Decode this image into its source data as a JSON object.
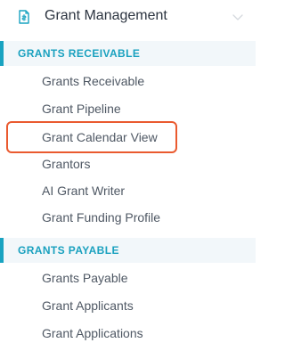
{
  "header": {
    "title": "Grant Management",
    "icon": "document-icon",
    "expand_icon": "chevron-down-icon"
  },
  "sections": [
    {
      "label": "GRANTS RECEIVABLE",
      "items": [
        {
          "label": "Grants Receivable"
        },
        {
          "label": "Grant Pipeline"
        },
        {
          "label": "Grant Calendar View",
          "highlighted": true
        },
        {
          "label": "Grantors"
        },
        {
          "label": "AI Grant Writer"
        },
        {
          "label": "Grant Funding Profile"
        }
      ]
    },
    {
      "label": "GRANTS PAYABLE",
      "items": [
        {
          "label": "Grants Payable"
        },
        {
          "label": "Grant Applicants"
        },
        {
          "label": "Grant Applications"
        }
      ]
    }
  ],
  "colors": {
    "accent": "#19a3c1",
    "section_bg": "#f2f7fa",
    "highlight_border": "#ea5a2f",
    "item_text": "#4f5864",
    "title_text": "#2c3440"
  }
}
